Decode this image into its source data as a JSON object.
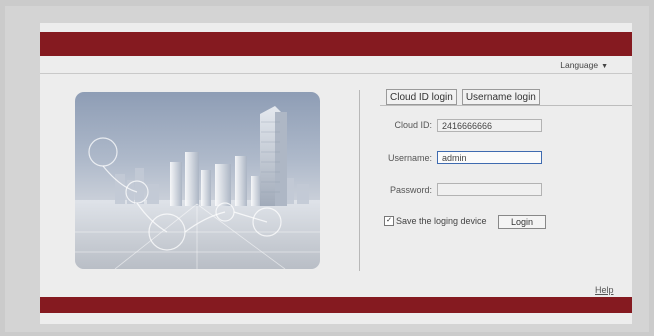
{
  "header": {
    "language_label": "Language"
  },
  "tabs": [
    {
      "label": "Cloud ID login"
    },
    {
      "label": "Username login"
    }
  ],
  "form": {
    "cloud_id_label": "Cloud ID:",
    "cloud_id_value": "2416666666",
    "username_label": "Username:",
    "username_value": "admin",
    "password_label": "Password:",
    "password_value": "",
    "save_device_label": "Save the loging device",
    "save_device_checked": true,
    "login_label": "Login"
  },
  "footer": {
    "help_label": "Help"
  },
  "colors": {
    "brand_bar": "#851a20",
    "active_border": "#3f6bb0"
  },
  "icons": {
    "language": "caret-down-icon",
    "checkbox": "checkbox-checked-icon"
  }
}
